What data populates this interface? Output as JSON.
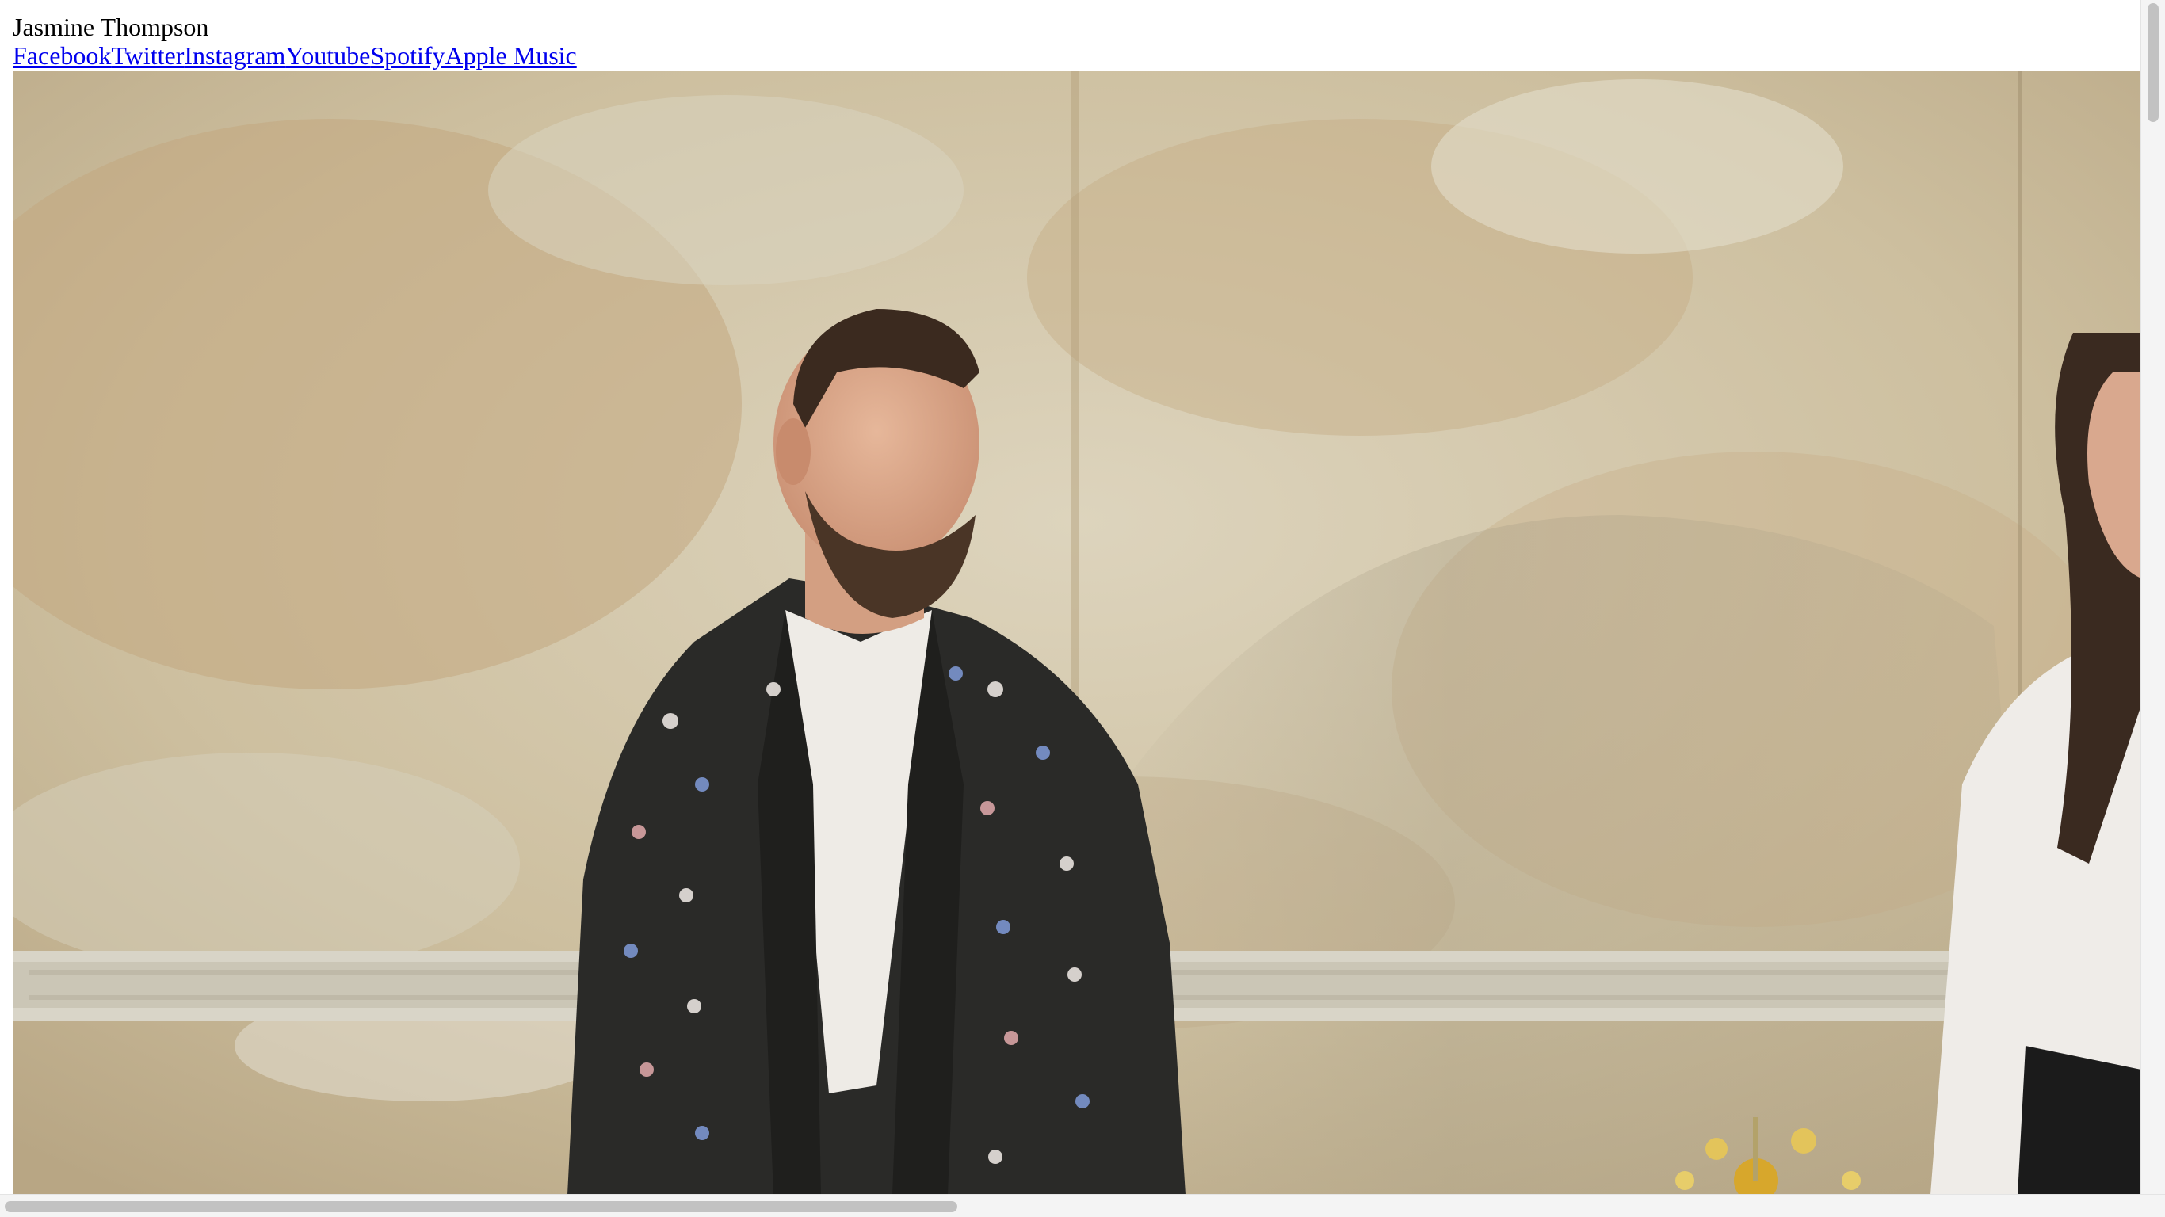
{
  "site": {
    "title": "Jasmine Thompson"
  },
  "social_links": [
    {
      "label": "Facebook",
      "icon": "facebook"
    },
    {
      "label": "Twitter",
      "icon": "twitter"
    },
    {
      "label": "Instagram",
      "icon": "instagram"
    },
    {
      "label": "Youtube",
      "icon": "youtube"
    },
    {
      "label": "Spotify",
      "icon": "spotify"
    },
    {
      "label": "Apple Music",
      "icon": "apple-music"
    }
  ],
  "colors": {
    "link": "#0000ee",
    "wall": "#cfc2a6",
    "shirt": "#2a2a28"
  }
}
